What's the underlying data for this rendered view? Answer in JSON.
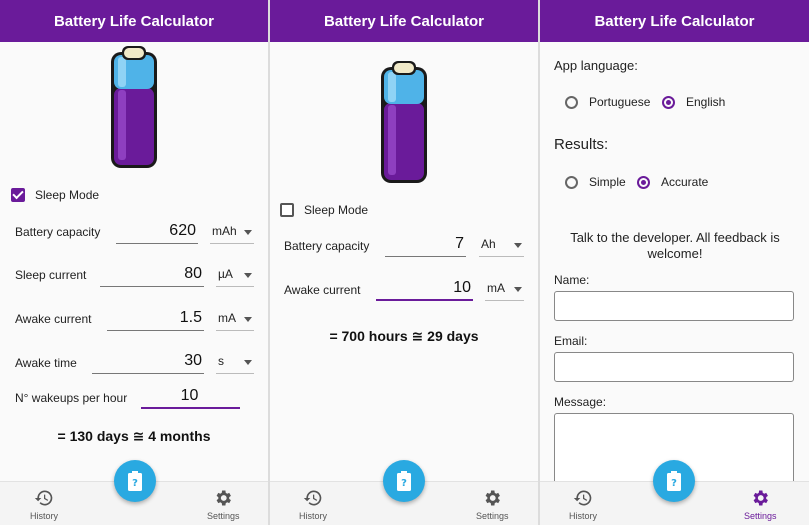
{
  "app_title": "Battery Life Calculator",
  "colors": {
    "primary": "#6a1b9a",
    "fab": "#29a9e1",
    "battery_body": "#6a1b9a",
    "battery_top": "#4fb3e8"
  },
  "screen1": {
    "sleep_mode": {
      "label": "Sleep Mode",
      "checked": true
    },
    "fields": [
      {
        "label": "Battery capacity",
        "value": "620",
        "unit": "mAh"
      },
      {
        "label": "Sleep current",
        "value": "80",
        "unit": "µA"
      },
      {
        "label": "Awake current",
        "value": "1.5",
        "unit": "mA"
      },
      {
        "label": "Awake time",
        "value": "30",
        "unit": "s"
      },
      {
        "label": "N° wakeups per hour",
        "value": "10"
      }
    ],
    "result": "= 130 days ≅ 4 months"
  },
  "screen2": {
    "sleep_mode": {
      "label": "Sleep Mode",
      "checked": false
    },
    "fields": [
      {
        "label": "Battery capacity",
        "value": "7",
        "unit": "Ah"
      },
      {
        "label": "Awake current",
        "value": "10",
        "unit": "mA"
      }
    ],
    "result": "= 700 hours ≅ 29 days"
  },
  "settings": {
    "language_heading": "App language:",
    "language_options": [
      "Portuguese",
      "English"
    ],
    "language_selected": "English",
    "results_heading": "Results:",
    "results_options": [
      "Simple",
      "Accurate"
    ],
    "results_selected": "Accurate",
    "feedback_text": "Talk to the developer. All feedback is welcome!",
    "name_label": "Name:",
    "email_label": "Email:",
    "message_label": "Message:"
  },
  "nav": {
    "history": "History",
    "settings": "Settings"
  },
  "icons": {
    "history": "history-icon",
    "settings": "gear-icon",
    "fab": "battery-question-icon",
    "battery": "aa-battery-icon"
  }
}
